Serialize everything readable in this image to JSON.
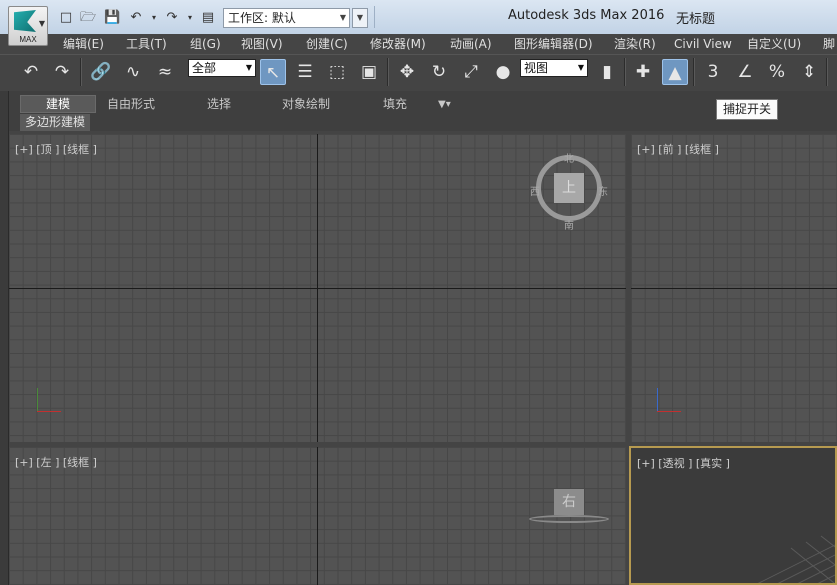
{
  "title_bar": {
    "app_title": "Autodesk 3ds Max 2016",
    "doc_title": "无标题",
    "logo_text": "MAX",
    "workspace_value": "工作区: 默认"
  },
  "menu": [
    "编辑(E)",
    "工具(T)",
    "组(G)",
    "视图(V)",
    "创建(C)",
    "修改器(M)",
    "动画(A)",
    "图形编辑器(D)",
    "渲染(R)",
    "Civil View",
    "自定义(U)",
    "脚"
  ],
  "toolbar": {
    "selection_filter": "全部",
    "ref_coord": "视图",
    "snap_label": "3",
    "angle_label": "%"
  },
  "ribbon_tabs": [
    "建模",
    "自由形式",
    "选择",
    "对象绘制",
    "填充"
  ],
  "subpanel_label": "多边形建模",
  "tooltip": "捕捉开关",
  "viewports": {
    "top": {
      "label": "[+] [顶 ] [线框 ]",
      "viewcube": "上",
      "north": "北",
      "south": "南",
      "east": "东",
      "west": "西"
    },
    "front": {
      "label": "[+] [前 ] [线框 ]"
    },
    "left": {
      "label": "[+] [左 ] [线框 ]",
      "viewcube": "右"
    },
    "perspective": {
      "label": "[+] [透视 ] [真实 ]"
    }
  },
  "colors": {
    "accent": "#6f97c1",
    "active_viewport_border": "#b69a50",
    "grid": "#535353"
  }
}
